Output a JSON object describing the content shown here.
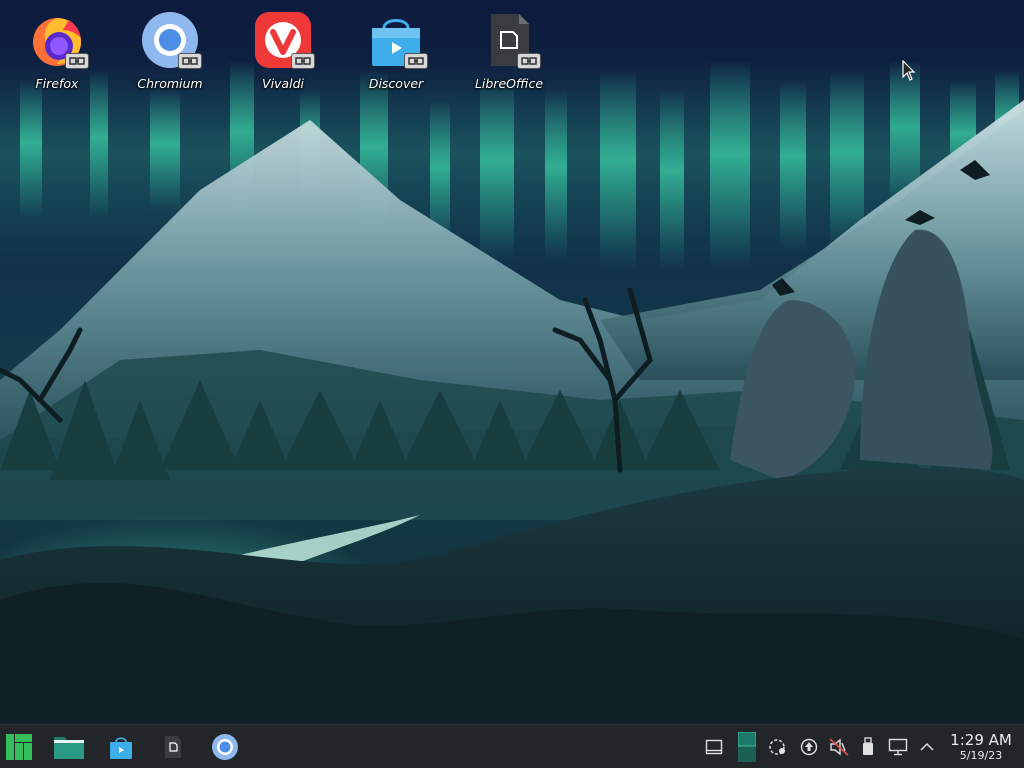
{
  "desktop": {
    "icons": [
      {
        "label": "Firefox",
        "icon": "firefox-icon"
      },
      {
        "label": "Chromium",
        "icon": "chromium-icon"
      },
      {
        "label": "Vivaldi",
        "icon": "vivaldi-icon"
      },
      {
        "label": "Discover",
        "icon": "discover-icon"
      },
      {
        "label": "LibreOffice",
        "icon": "libreoffice-icon"
      }
    ],
    "wallpaper": "aurora-mountains-landscape"
  },
  "taskbar": {
    "launchers": [
      {
        "name": "application-menu",
        "icon": "manjaro-logo-icon"
      },
      {
        "name": "file-manager",
        "icon": "folder-icon"
      },
      {
        "name": "discover",
        "icon": "discover-icon"
      },
      {
        "name": "libreoffice",
        "icon": "libreoffice-icon"
      },
      {
        "name": "chromium",
        "icon": "chromium-icon"
      }
    ],
    "tray": [
      {
        "name": "show-desktop",
        "icon": "show-desktop-icon"
      },
      {
        "name": "pager",
        "icon": "pager-icon"
      },
      {
        "name": "network-disconnected",
        "icon": "network-icon"
      },
      {
        "name": "updates",
        "icon": "update-arrow-icon"
      },
      {
        "name": "volume-muted",
        "icon": "speaker-muted-icon"
      },
      {
        "name": "removable-device",
        "icon": "usb-icon"
      },
      {
        "name": "display",
        "icon": "display-icon"
      },
      {
        "name": "expand-tray",
        "icon": "chevron-up-icon"
      }
    ],
    "clock": {
      "time": "1:29 AM",
      "date": "5/19/23"
    }
  },
  "colors": {
    "taskbar_bg": "#232629",
    "aurora": "#3fe0b0",
    "sky_top": "#0d1b3e",
    "accent_teal": "#1d7a6a"
  }
}
